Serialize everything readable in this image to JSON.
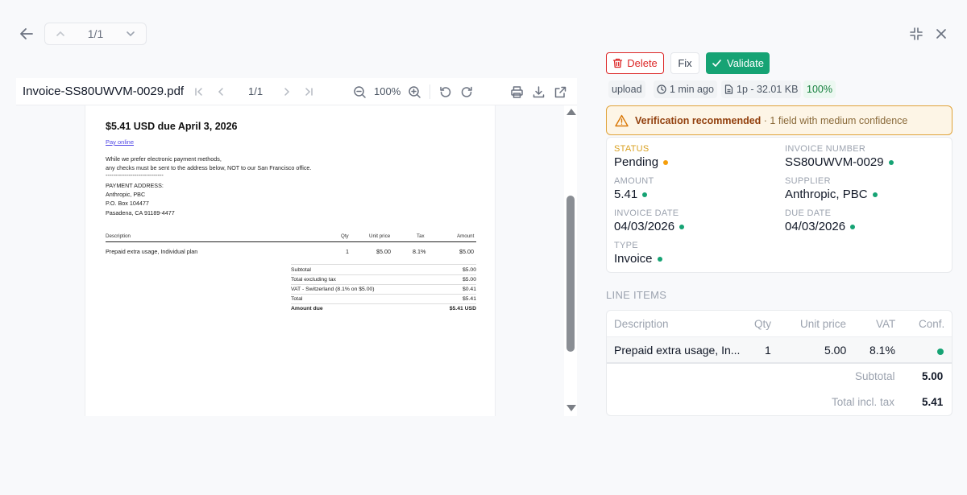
{
  "topbar": {
    "pager_label": "1/1",
    "icons": [
      "arrow-left-icon",
      "chevron-up-icon",
      "chevron-down-icon",
      "collapse-icon",
      "close-icon"
    ]
  },
  "viewer": {
    "filename": "Invoice-SS80UWVM-0029.pdf",
    "page_label": "1/1",
    "zoom": "100%"
  },
  "document": {
    "title": "$5.41 USD due April 3, 2026",
    "pay_link": "Pay online",
    "note_line1": "While we prefer electronic payment methods,",
    "note_line2": "any checks must be sent to the address below, NOT to our San Francisco office.",
    "dashes": "------------------------------",
    "addr_label": "PAYMENT ADDRESS:",
    "addr1": "Anthropic, PBC",
    "addr2": "P.O. Box 104477",
    "addr3": "Pasadena, CA 91189-4477",
    "headers": {
      "description": "Description",
      "qty": "Qty",
      "unit_price": "Unit price",
      "tax": "Tax",
      "amount": "Amount"
    },
    "row": {
      "description": "Prepaid extra usage, Individual plan",
      "qty": "1",
      "unit_price": "$5.00",
      "tax": "8.1%",
      "amount": "$5.00"
    },
    "totals": [
      {
        "label": "Subtotal",
        "value": "$5.00"
      },
      {
        "label": "Total excluding tax",
        "value": "$5.00"
      },
      {
        "label": "VAT - Switzerland (8.1% on $5.00)",
        "value": "$0.41"
      },
      {
        "label": "Total",
        "value": "$5.41"
      },
      {
        "label": "Amount due",
        "value": "$5.41 USD"
      }
    ]
  },
  "actions": {
    "delete": "Delete",
    "fix": "Fix",
    "validate": "Validate"
  },
  "meta": {
    "source": "upload",
    "time": "1 min ago",
    "size": "1p - 32.01 KB",
    "confidence": "100%"
  },
  "banner": {
    "bold": "Verification recommended",
    "rest": " · 1 field with medium confidence"
  },
  "fields": {
    "status": {
      "label": "STATUS",
      "value": "Pending"
    },
    "invoice_number": {
      "label": "INVOICE NUMBER",
      "value": "SS80UWVM-0029"
    },
    "amount": {
      "label": "AMOUNT",
      "value": "5.41"
    },
    "supplier": {
      "label": "SUPPLIER",
      "value": "Anthropic, PBC"
    },
    "invoice_date": {
      "label": "INVOICE DATE",
      "value": "04/03/2026"
    },
    "due_date": {
      "label": "DUE DATE",
      "value": "04/03/2026"
    },
    "type": {
      "label": "TYPE",
      "value": "Invoice"
    }
  },
  "line_items": {
    "title": "LINE ITEMS",
    "headers": {
      "description": "Description",
      "qty": "Qty",
      "unit_price": "Unit price",
      "vat": "VAT",
      "conf": "Conf."
    },
    "rows": [
      {
        "description": "Prepaid extra usage, In...",
        "qty": "1",
        "unit_price": "5.00",
        "vat": "8.1%"
      }
    ],
    "subtotal_label": "Subtotal",
    "subtotal": "5.00",
    "total_label": "Total incl. tax",
    "total": "5.41"
  },
  "colors": {
    "accent": "#16a374",
    "danger": "#dc2626",
    "warning": "#f59e0b"
  }
}
